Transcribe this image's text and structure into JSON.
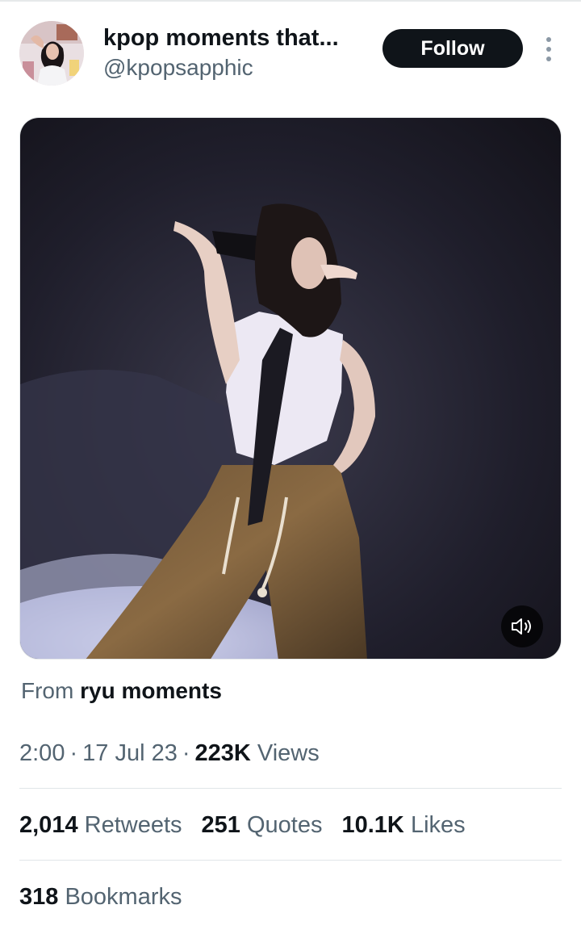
{
  "author": {
    "display_name": "kpop moments that...",
    "handle": "@kpopsapphic"
  },
  "actions": {
    "follow_label": "Follow",
    "more_icon": "more-vertical-icon"
  },
  "media": {
    "type": "video",
    "mute_icon": "speaker-icon"
  },
  "source": {
    "prefix": "From",
    "name": "ryu moments"
  },
  "meta": {
    "time": "2:00",
    "separator": "·",
    "date": "17 Jul 23",
    "views_count": "223K",
    "views_label": "Views"
  },
  "stats": {
    "retweets_count": "2,014",
    "retweets_label": "Retweets",
    "quotes_count": "251",
    "quotes_label": "Quotes",
    "likes_count": "10.1K",
    "likes_label": "Likes",
    "bookmarks_count": "318",
    "bookmarks_label": "Bookmarks"
  },
  "colors": {
    "text_primary": "#0f1419",
    "text_secondary": "#536471",
    "button_dark": "#0f1419",
    "divider": "#e1e6e8"
  }
}
